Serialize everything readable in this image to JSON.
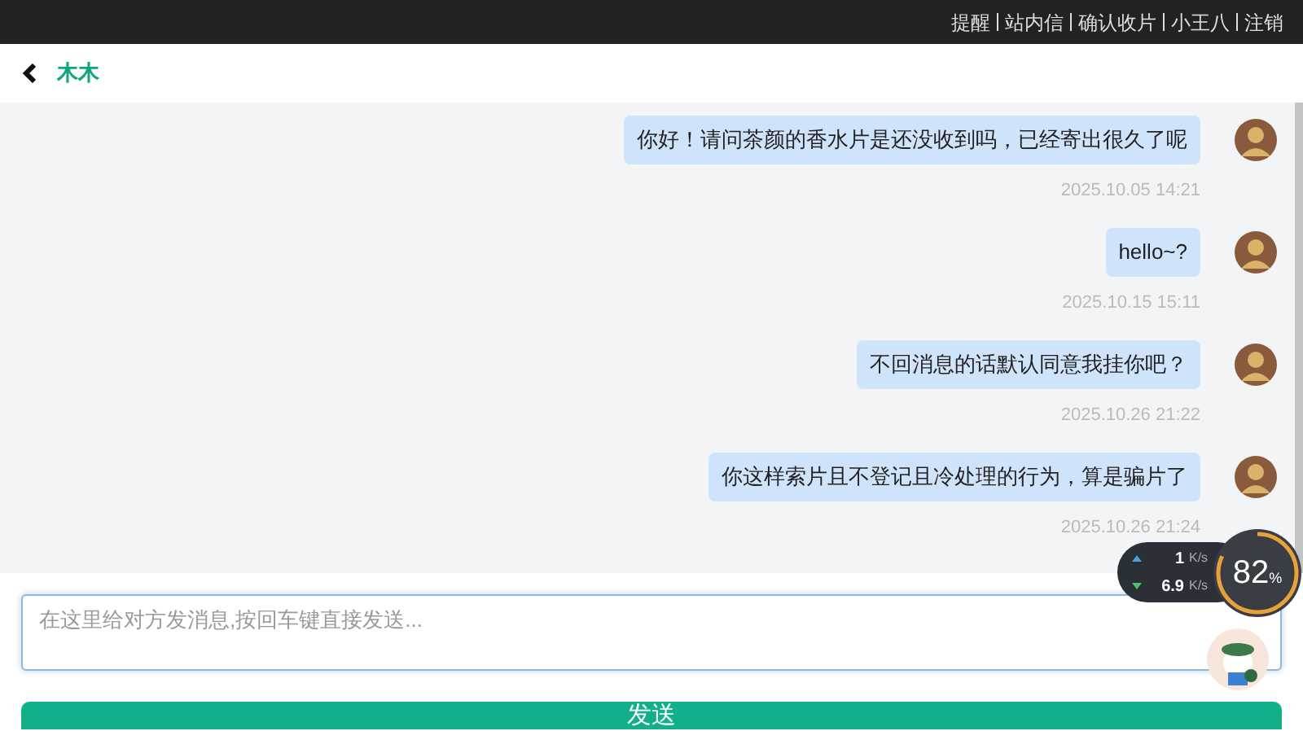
{
  "top_links": [
    "提醒",
    "站内信",
    "确认收片",
    "小王八",
    "注销"
  ],
  "chat": {
    "contact": "木木"
  },
  "messages": [
    {
      "text": "你好！请问茶颜的香水片是还没收到吗，已经寄出很久了呢",
      "time": "2025.10.05 14:21"
    },
    {
      "text": "hello~?",
      "time": "2025.10.15 15:11"
    },
    {
      "text": "不回消息的话默认同意我挂你吧？",
      "time": "2025.10.26 21:22"
    },
    {
      "text": "你这样索片且不登记且冷处理的行为，算是骗片了",
      "time": "2025.10.26 21:24"
    }
  ],
  "composer": {
    "placeholder": "在这里给对方发消息,按回车键直接发送...",
    "send_button": "发送"
  },
  "speed_widget": {
    "up": "1",
    "up_unit": "K/s",
    "down": "6.9",
    "down_unit": "K/s",
    "percent": "82",
    "percent_sign": "%",
    "level": 0.82
  }
}
